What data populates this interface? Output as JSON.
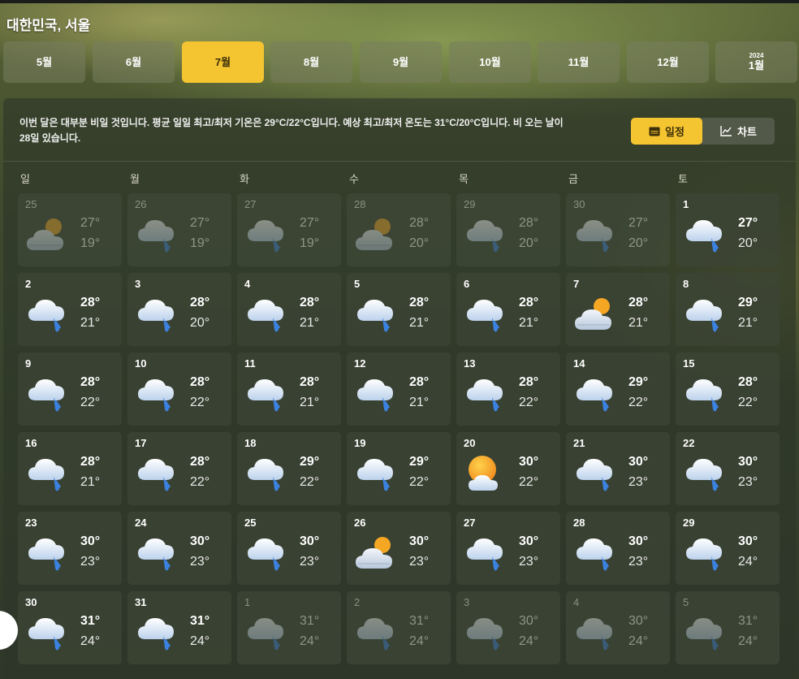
{
  "location": "대한민국, 서울",
  "months": [
    {
      "label": "5월",
      "year": "",
      "active": false
    },
    {
      "label": "6월",
      "year": "",
      "active": false
    },
    {
      "label": "7월",
      "year": "",
      "active": true
    },
    {
      "label": "8월",
      "year": "",
      "active": false
    },
    {
      "label": "9월",
      "year": "",
      "active": false
    },
    {
      "label": "10월",
      "year": "",
      "active": false
    },
    {
      "label": "11월",
      "year": "",
      "active": false
    },
    {
      "label": "12월",
      "year": "",
      "active": false
    },
    {
      "label": "1월",
      "year": "2024",
      "active": false
    }
  ],
  "summary": "이번 달은 대부분 비일 것입니다. 평균 일일 최고/최저 기온은 29°C/22°C입니다. 예상 최고/최저 온도는 31°C/20°C입니다. 비 오는 날이 28일 있습니다.",
  "view_toggle": {
    "calendar_label": "일정",
    "chart_label": "차트",
    "active": "calendar"
  },
  "weekdays": [
    "일",
    "월",
    "화",
    "수",
    "목",
    "금",
    "토"
  ],
  "days": [
    {
      "day": "25",
      "hi": "27°",
      "lo": "19°",
      "icon": "partly-cloudy-icon",
      "other": true
    },
    {
      "day": "26",
      "hi": "27°",
      "lo": "19°",
      "icon": "rain-icon",
      "other": true
    },
    {
      "day": "27",
      "hi": "27°",
      "lo": "19°",
      "icon": "rain-icon",
      "other": true
    },
    {
      "day": "28",
      "hi": "28°",
      "lo": "20°",
      "icon": "partly-cloudy-icon",
      "other": true
    },
    {
      "day": "29",
      "hi": "28°",
      "lo": "20°",
      "icon": "rain-icon",
      "other": true
    },
    {
      "day": "30",
      "hi": "27°",
      "lo": "20°",
      "icon": "rain-icon",
      "other": true
    },
    {
      "day": "1",
      "hi": "27°",
      "lo": "20°",
      "icon": "rain-icon",
      "other": false
    },
    {
      "day": "2",
      "hi": "28°",
      "lo": "21°",
      "icon": "rain-icon",
      "other": false
    },
    {
      "day": "3",
      "hi": "28°",
      "lo": "20°",
      "icon": "rain-icon",
      "other": false
    },
    {
      "day": "4",
      "hi": "28°",
      "lo": "21°",
      "icon": "rain-icon",
      "other": false
    },
    {
      "day": "5",
      "hi": "28°",
      "lo": "21°",
      "icon": "rain-icon",
      "other": false
    },
    {
      "day": "6",
      "hi": "28°",
      "lo": "21°",
      "icon": "rain-icon",
      "other": false
    },
    {
      "day": "7",
      "hi": "28°",
      "lo": "21°",
      "icon": "partly-cloudy-icon",
      "other": false
    },
    {
      "day": "8",
      "hi": "29°",
      "lo": "21°",
      "icon": "rain-icon",
      "other": false
    },
    {
      "day": "9",
      "hi": "28°",
      "lo": "22°",
      "icon": "rain-icon",
      "other": false
    },
    {
      "day": "10",
      "hi": "28°",
      "lo": "22°",
      "icon": "rain-icon",
      "other": false
    },
    {
      "day": "11",
      "hi": "28°",
      "lo": "21°",
      "icon": "rain-icon",
      "other": false
    },
    {
      "day": "12",
      "hi": "28°",
      "lo": "21°",
      "icon": "rain-icon",
      "other": false
    },
    {
      "day": "13",
      "hi": "28°",
      "lo": "22°",
      "icon": "rain-icon",
      "other": false
    },
    {
      "day": "14",
      "hi": "29°",
      "lo": "22°",
      "icon": "rain-icon",
      "other": false
    },
    {
      "day": "15",
      "hi": "28°",
      "lo": "22°",
      "icon": "rain-icon",
      "other": false
    },
    {
      "day": "16",
      "hi": "28°",
      "lo": "21°",
      "icon": "rain-icon",
      "other": false
    },
    {
      "day": "17",
      "hi": "28°",
      "lo": "22°",
      "icon": "rain-icon",
      "other": false
    },
    {
      "day": "18",
      "hi": "29°",
      "lo": "22°",
      "icon": "rain-icon",
      "other": false
    },
    {
      "day": "19",
      "hi": "29°",
      "lo": "22°",
      "icon": "rain-icon",
      "other": false
    },
    {
      "day": "20",
      "hi": "30°",
      "lo": "22°",
      "icon": "sunny-cloud-icon",
      "other": false
    },
    {
      "day": "21",
      "hi": "30°",
      "lo": "23°",
      "icon": "rain-icon",
      "other": false
    },
    {
      "day": "22",
      "hi": "30°",
      "lo": "23°",
      "icon": "rain-icon",
      "other": false
    },
    {
      "day": "23",
      "hi": "30°",
      "lo": "23°",
      "icon": "rain-icon",
      "other": false
    },
    {
      "day": "24",
      "hi": "30°",
      "lo": "23°",
      "icon": "rain-icon",
      "other": false
    },
    {
      "day": "25",
      "hi": "30°",
      "lo": "23°",
      "icon": "rain-icon",
      "other": false
    },
    {
      "day": "26",
      "hi": "30°",
      "lo": "23°",
      "icon": "partly-cloudy-icon",
      "other": false
    },
    {
      "day": "27",
      "hi": "30°",
      "lo": "23°",
      "icon": "rain-icon",
      "other": false
    },
    {
      "day": "28",
      "hi": "30°",
      "lo": "23°",
      "icon": "rain-icon",
      "other": false
    },
    {
      "day": "29",
      "hi": "30°",
      "lo": "24°",
      "icon": "rain-icon",
      "other": false
    },
    {
      "day": "30",
      "hi": "31°",
      "lo": "24°",
      "icon": "rain-icon",
      "other": false
    },
    {
      "day": "31",
      "hi": "31°",
      "lo": "24°",
      "icon": "rain-icon",
      "other": false
    },
    {
      "day": "1",
      "hi": "31°",
      "lo": "24°",
      "icon": "rain-icon",
      "other": true
    },
    {
      "day": "2",
      "hi": "31°",
      "lo": "24°",
      "icon": "rain-icon",
      "other": true
    },
    {
      "day": "3",
      "hi": "30°",
      "lo": "24°",
      "icon": "rain-icon",
      "other": true
    },
    {
      "day": "4",
      "hi": "30°",
      "lo": "24°",
      "icon": "rain-icon",
      "other": true
    },
    {
      "day": "5",
      "hi": "31°",
      "lo": "24°",
      "icon": "rain-icon",
      "other": true
    }
  ],
  "colors": {
    "accent": "#f5c431",
    "sun": "#f5a623",
    "rain": "#3b82e0"
  }
}
